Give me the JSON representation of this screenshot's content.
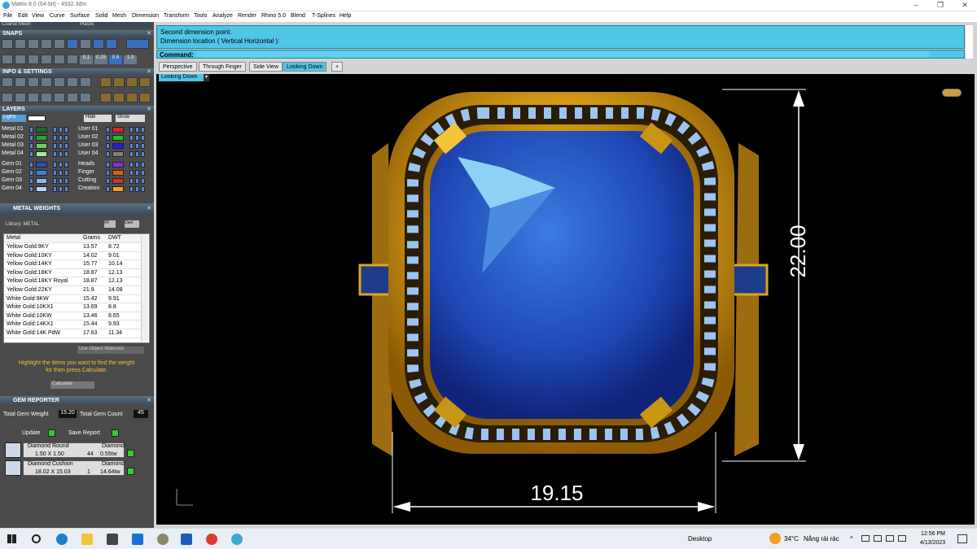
{
  "app": {
    "title": "Matrix 8.0 (64-bit) - 4932.3dm"
  },
  "window_controls": {
    "minimize": "–",
    "maximize": "❐",
    "close": "✕"
  },
  "menu": [
    "File",
    "Edit",
    "View",
    "Curve",
    "Surface",
    "Solid",
    "Mesh",
    "Dimension",
    "Transform",
    "Tools",
    "Analyze",
    "Render",
    "Rhino 5.0",
    "Blend",
    "T-Splines",
    "Help"
  ],
  "panel": {
    "mesh_select": "Coarse Mesh",
    "material_select": "Plastic",
    "snaps_title": "SNAPS",
    "snap_values": [
      "0.1",
      "0.25",
      "0.5",
      "1.0"
    ],
    "info_title": "INFO & SETTINGS",
    "layers_title": "LAYERS",
    "lights_label": "Lights",
    "hide_label": "Hide",
    "show_label": "Show",
    "layers_left": [
      {
        "name": "Metal 01",
        "color": "#1a6d2a"
      },
      {
        "name": "Metal 02",
        "color": "#25a23a"
      },
      {
        "name": "Metal 03",
        "color": "#6fd06b"
      },
      {
        "name": "Metal 04",
        "color": "#9ef09a"
      },
      {
        "name": "Gem 01",
        "color": "#2453b8"
      },
      {
        "name": "Gem 02",
        "color": "#3f7ee0"
      },
      {
        "name": "Gem 03",
        "color": "#8db8f2"
      },
      {
        "name": "Gem 04",
        "color": "#b9d6fa"
      }
    ],
    "layers_right": [
      {
        "name": "User 01",
        "color": "#e02020"
      },
      {
        "name": "User 02",
        "color": "#20c020"
      },
      {
        "name": "User 03",
        "color": "#2020e0"
      },
      {
        "name": "User 04",
        "color": "#808080"
      },
      {
        "name": "Heads",
        "color": "#8a2bd0"
      },
      {
        "name": "Finger",
        "color": "#e06010"
      },
      {
        "name": "Cutting",
        "color": "#d03030"
      },
      {
        "name": "Creation",
        "color": "#f0a020"
      }
    ],
    "metal_weights_title": "METAL WEIGHTS",
    "library_label": "Library: METAL",
    "lib_btn_1": "0V",
    "lib_btn_2": "User",
    "table_headers": [
      "Metal",
      "Grams",
      "DWT"
    ],
    "metal_rows": [
      [
        "Yellow Gold:9KY",
        "13.57",
        "8.72"
      ],
      [
        "Yellow Gold:10KY",
        "14.02",
        "9.01"
      ],
      [
        "Yellow Gold:14KY",
        "15.77",
        "10.14"
      ],
      [
        "Yellow Gold:18KY",
        "18.87",
        "12.13"
      ],
      [
        "Yellow Gold:18KY Royal",
        "18.87",
        "12.13"
      ],
      [
        "Yellow Gold:22KY",
        "21.9",
        "14.08"
      ],
      [
        "White Gold:9KW",
        "15.42",
        "9.91"
      ],
      [
        "White Gold:10KX1",
        "13.69",
        "8.8"
      ],
      [
        "White Gold:10KW",
        "13.46",
        "8.65"
      ],
      [
        "White Gold:14KX1",
        "15.44",
        "9.93"
      ],
      [
        "White Gold:14K PdW",
        "17.63",
        "11.34"
      ]
    ],
    "use_object_materials": "Use Object Materials",
    "highlight_msg_1": "Highlight the items you want to find the weight",
    "highlight_msg_2": "for then press Calculate.",
    "calculate_label": "Calculate",
    "gem_reporter_title": "GEM REPORTER",
    "total_gem_weight_label": "Total Gem Weight",
    "total_gem_weight": "15.20",
    "total_gem_count_label": "Total Gem Count",
    "total_gem_count": "45",
    "update_label": "Update",
    "save_report_label": "Save Report",
    "gems": [
      {
        "name": "Diamond Round",
        "type": "Diamond",
        "size": "1.50 X 1.50",
        "count": "44",
        "weight": "0.55tw"
      },
      {
        "name": "Diamond Cushion",
        "type": "Diamond",
        "size": "18.02 X 15.03",
        "count": "1",
        "weight": "14.64tw"
      }
    ]
  },
  "command": {
    "line1": "Second dimension point.",
    "line2": "Dimension location ( Vertical  Horizontal ):",
    "prompt": "Command:"
  },
  "view_tabs": [
    "Perspective",
    "Through Finger",
    "Side View",
    "Looking Down",
    "+"
  ],
  "active_view": "Looking Down",
  "viewport": {
    "dim_height": "22.00",
    "dim_width": "19.15"
  },
  "taskbar": {
    "desktop_label": "Desktop",
    "weather": "34°C",
    "weather_desc": "Nắng rải rác",
    "time": "12:56 PM",
    "date": "4/13/2023"
  }
}
